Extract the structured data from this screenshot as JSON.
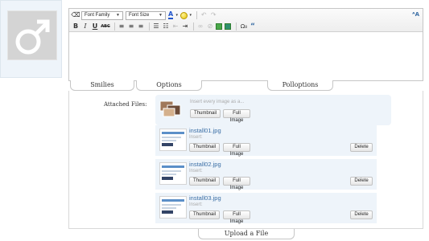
{
  "editor": {
    "toolbar": {
      "font_family_label": "Font Family",
      "font_size_label": "Font Size",
      "bold": "B",
      "italic": "I",
      "underline": "U",
      "strikethrough": "ABC",
      "quote": "“",
      "font_color_glyph": "A",
      "icons": [
        "eraser-icon",
        "font-color-icon",
        "smiley-icon",
        "undo-icon",
        "redo-icon",
        "bold-icon",
        "italic-icon",
        "underline-icon",
        "strikethrough-icon",
        "align-left-icon",
        "align-center-icon",
        "align-right-icon",
        "unordered-list-icon",
        "ordered-list-icon",
        "outdent-icon",
        "indent-icon",
        "link-icon",
        "unlink-icon",
        "image-icon",
        "media-icon",
        "code-icon",
        "quote-icon",
        "text-size-icon"
      ]
    },
    "tabs": [
      "Smilies",
      "Options",
      "Polloptions"
    ]
  },
  "attachments": {
    "label": "Attached Files:",
    "drop_hint": "Insert every image as a...",
    "thumbnail_label": "Thumbnail",
    "full_image_label": "Full Image",
    "insert_label": "Insert:",
    "delete_label": "Delete",
    "files": [
      {
        "name": "install01.jpg"
      },
      {
        "name": "install02.jpg"
      },
      {
        "name": "install03.jpg"
      }
    ]
  },
  "upload_label": "Upload  a File",
  "colors": {
    "panel_bg": "#eef4fa",
    "link_blue": "#3a6ea5",
    "avatar_bg": "#d4d4d4"
  }
}
